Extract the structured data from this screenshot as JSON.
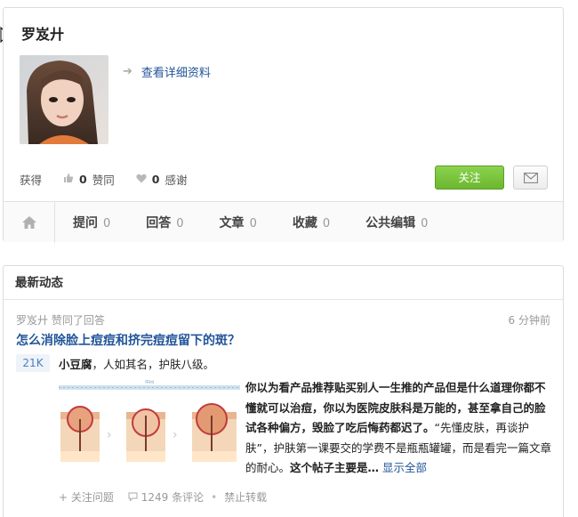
{
  "profile": {
    "name": "罗岌廾",
    "detail_link": "查看详细资料",
    "stats_prefix": "获得",
    "upvotes_count": "0",
    "upvotes_label": "赞同",
    "thanks_count": "0",
    "thanks_label": "感谢",
    "follow_label": "关注"
  },
  "tabs": [
    {
      "label": "提问",
      "count": "0"
    },
    {
      "label": "回答",
      "count": "0"
    },
    {
      "label": "文章",
      "count": "0"
    },
    {
      "label": "收藏",
      "count": "0"
    },
    {
      "label": "公共编辑",
      "count": "0"
    }
  ],
  "feed": {
    "header": "最新动态",
    "activity_actor": "罗岌廾",
    "activity_action": "赞同了回答",
    "timestamp": "6 分钟前",
    "question_title": "怎么消除脸上痘痘和挤完痘痘留下的斑？",
    "vote_count": "21K",
    "author_name": "小豆腐",
    "author_bio": "，人如其名，护肤八级。",
    "answer_bold": "你以为看产品推荐贴买别人一生推的产品但是什么道理你都不懂就可以治痘，你以为医院皮肤科是万能的，甚至拿自己的脸试各种偏方，毁脸了吃后悔药都迟了。",
    "answer_quote": "“先懂皮肤，再谈护肤”",
    "answer_rest": "，护肤第一课要交的学费不是瓶瓶罐罐，而是看完一篇文章的耐心。",
    "answer_tail": "这个帖子主要是…",
    "show_all": "显示全部",
    "follow_question": "关注问题",
    "comments": "1249 条评论",
    "no_repost": "禁止转载"
  },
  "colors": {
    "link": "#225599",
    "follow_button": "#6cb72f",
    "badge_bg": "#eef3fa"
  }
}
